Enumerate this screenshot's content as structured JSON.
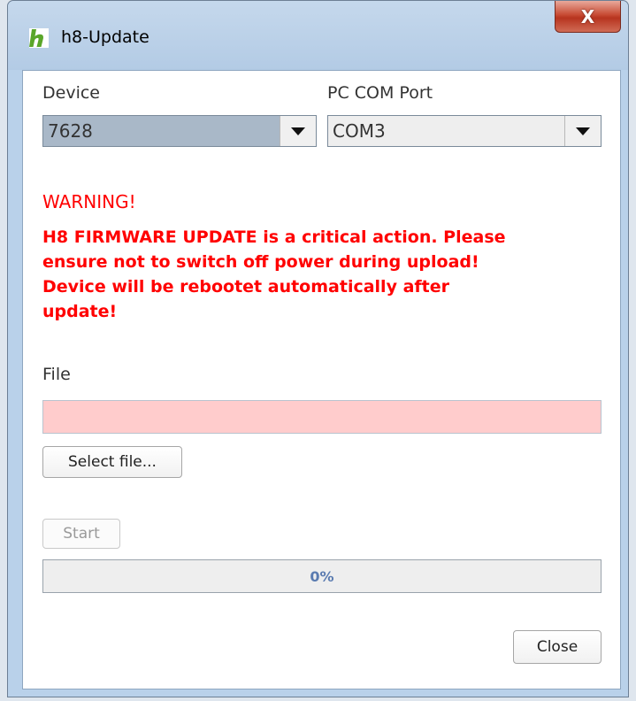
{
  "window": {
    "title": "h8-Update",
    "close_glyph": "X",
    "logo_color": "#5aa62a"
  },
  "device": {
    "label": "Device",
    "selected": "7628"
  },
  "com_port": {
    "label": "PC COM Port",
    "selected": "COM3"
  },
  "warning": {
    "heading": "WARNING!",
    "line1": "H8 FIRMWARE UPDATE is a critical action. Please",
    "line2": "ensure not to switch off power during upload!",
    "line3": "Device will be rebootet automatically after",
    "line4": "update!",
    "color": "#ff0000"
  },
  "file": {
    "label": "File",
    "value": "",
    "select_button": "Select file..."
  },
  "actions": {
    "start_button": "Start",
    "close_button": "Close"
  },
  "progress": {
    "value": 0,
    "label": "0%"
  }
}
